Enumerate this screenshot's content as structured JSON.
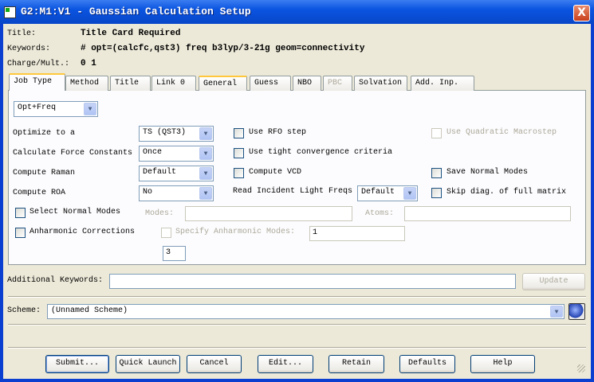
{
  "window": {
    "title": "G2:M1:V1 - Gaussian Calculation Setup",
    "close": "X"
  },
  "header": {
    "title_label": "Title:",
    "title_value": "Title Card Required",
    "keywords_label": "Keywords:",
    "keywords_value": "# opt=(calcfc,qst3) freq b3lyp/3-21g geom=connectivity",
    "charge_label": "Charge/Mult.:",
    "charge_value": "0 1"
  },
  "tabs": [
    {
      "label": "Job Type"
    },
    {
      "label": "Method"
    },
    {
      "label": "Title"
    },
    {
      "label": "Link 0"
    },
    {
      "label": "General"
    },
    {
      "label": "Guess"
    },
    {
      "label": "NBO"
    },
    {
      "label": "PBC"
    },
    {
      "label": "Solvation"
    },
    {
      "label": "Add. Inp."
    }
  ],
  "jobtype": {
    "job_combo": "Opt+Freq",
    "optimize_label": "Optimize to a",
    "optimize_value": "TS (QST3)",
    "force_label": "Calculate Force Constants",
    "force_value": "Once",
    "raman_label": "Compute Raman",
    "raman_value": "Default",
    "roa_label": "Compute ROA",
    "roa_value": "No",
    "rfo": "Use RFO step",
    "tight": "Use tight convergence criteria",
    "vcd": "Compute VCD",
    "incident_label": "Read Incident Light Freqs",
    "incident_value": "Default",
    "quadratic": "Use Quadratic Macrostep",
    "save_modes": "Save Normal Modes",
    "skip_diag": "Skip diag. of full matrix",
    "select_modes": "Select Normal Modes",
    "modes_label": "Modes:",
    "atoms_label": "Atoms:",
    "anharmonic": "Anharmonic Corrections",
    "specify_anh": "Specify Anharmonic Modes:",
    "specify_value": "1",
    "count_value": "3"
  },
  "additional": {
    "label": "Additional Keywords:",
    "value": "",
    "update": "Update"
  },
  "scheme": {
    "label": "Scheme:",
    "value": "(Unnamed Scheme)"
  },
  "buttons": [
    {
      "label": "Submit..."
    },
    {
      "label": "Quick Launch"
    },
    {
      "label": "Cancel"
    },
    {
      "label": "Edit..."
    },
    {
      "label": "Retain"
    },
    {
      "label": "Defaults"
    },
    {
      "label": "Help"
    }
  ]
}
